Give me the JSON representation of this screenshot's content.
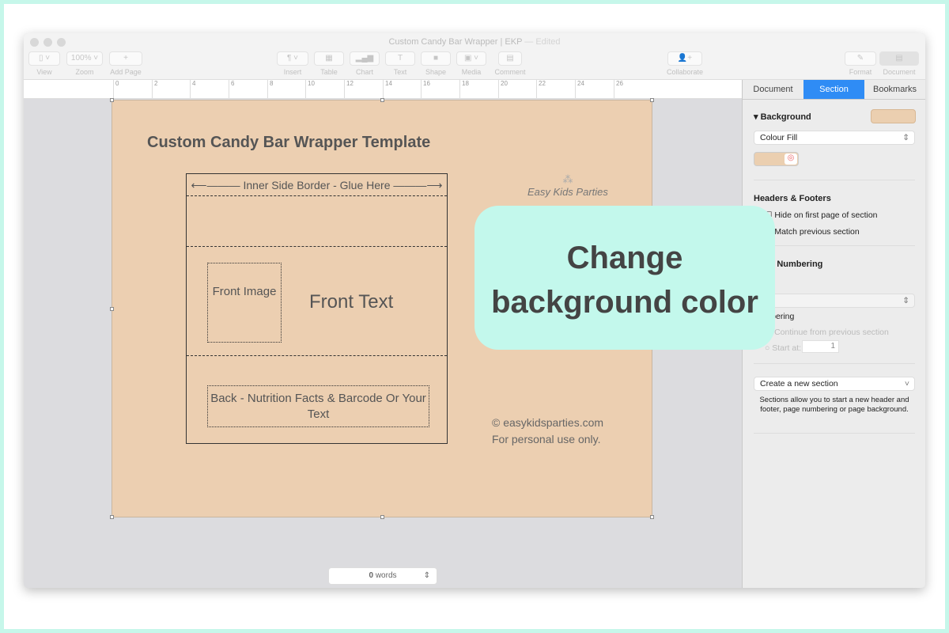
{
  "window": {
    "title": "Custom Candy Bar Wrapper | EKP",
    "edited": "— Edited"
  },
  "toolbar": {
    "view": "View",
    "zoom": "Zoom",
    "zoom_value": "100%",
    "add_page": "Add Page",
    "insert": "Insert",
    "table": "Table",
    "chart": "Chart",
    "text": "Text",
    "shape": "Shape",
    "media": "Media",
    "comment": "Comment",
    "collaborate": "Collaborate",
    "format": "Format",
    "document": "Document"
  },
  "ruler": [
    "0",
    "2",
    "4",
    "6",
    "8",
    "10",
    "12",
    "14",
    "16",
    "18",
    "20",
    "22",
    "24",
    "26"
  ],
  "page": {
    "title": "Custom Candy Bar Wrapper Template",
    "inner_border": "Inner Side Border - Glue Here",
    "front_image": "Front Image",
    "front_text": "Front Text",
    "back": "Back - Nutrition Facts & Barcode Or Your Text",
    "logo": "Easy Kids Parties",
    "site": "easykidsparties.com",
    "personal": "For personal use only."
  },
  "status": {
    "word_count": "0",
    "words_label": "words"
  },
  "sidebar": {
    "tabs": [
      "Document",
      "Section",
      "Bookmarks"
    ],
    "active_tab": "Section",
    "background": "Background",
    "background_color": "#ebcfb0",
    "fill_type": "Colour Fill",
    "headers_footers": "Headers & Footers",
    "hide_first": "Hide on first page of section",
    "match_prev": "Match previous section",
    "page_numbering": "Page Numbering",
    "numbering": "Numbering",
    "continue": "Continue from previous section",
    "start_at": "Start at:",
    "start_value": "1",
    "create_section": "Create a new section",
    "sections_help": "Sections allow you to start a new header and footer, page numbering or page background."
  },
  "callout": {
    "line1": "Change",
    "line2": "background color"
  }
}
